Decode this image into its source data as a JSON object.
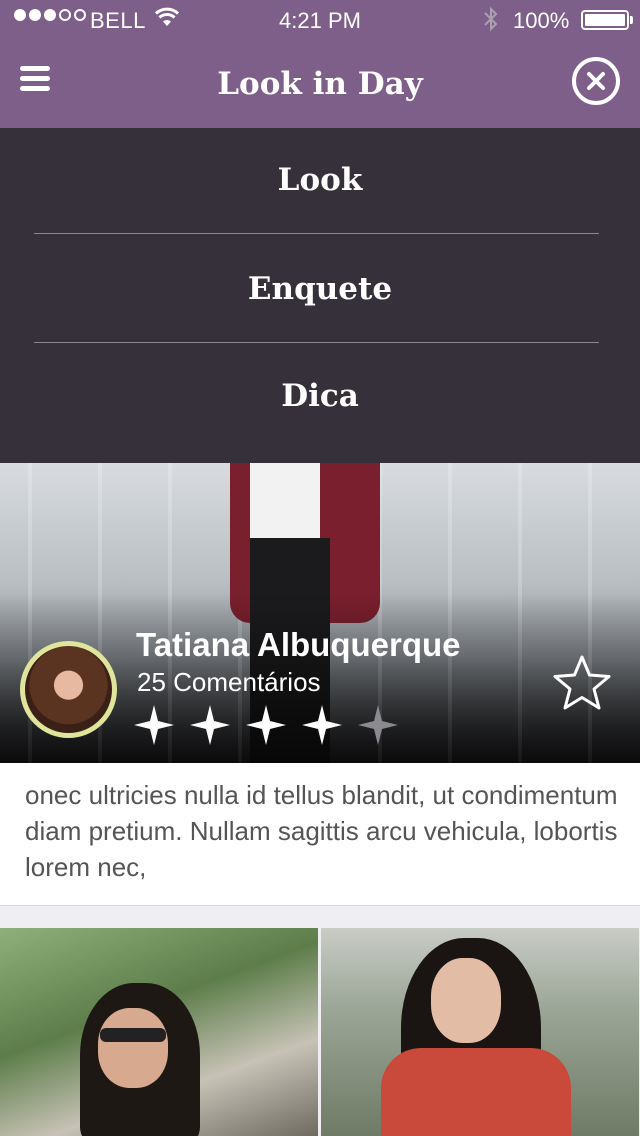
{
  "status_bar": {
    "carrier": "BELL",
    "time": "4:21 PM",
    "battery": "100%",
    "signal_bars_filled": 3,
    "signal_bars_total": 5
  },
  "header": {
    "title": "Look in Day",
    "menu_icon": "hamburger-icon",
    "close_icon": "close-circle-icon"
  },
  "menu": {
    "items": [
      {
        "label": "Look"
      },
      {
        "label": "Enquete"
      },
      {
        "label": "Dica"
      }
    ]
  },
  "featured": {
    "author": "Tatiana Albuquerque",
    "comments": "25 Comentários",
    "rating": 4,
    "rating_max": 5,
    "favorite_icon": "star-outline-icon",
    "description": "onec ultricies nulla id tellus blandit, ut condimentum diam pretium. Nullam sagittis arcu vehicula, lobortis lorem nec,"
  },
  "colors": {
    "header": "#7d5f8a",
    "menu_bg": "#35303a",
    "avatar_ring": "#dfe59b"
  }
}
